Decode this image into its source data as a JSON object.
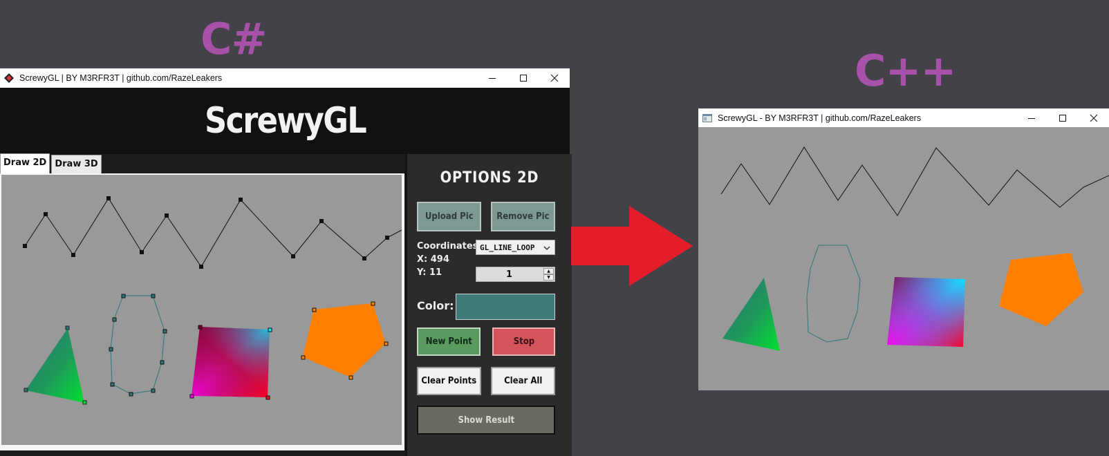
{
  "labels": {
    "left_lang": "C#",
    "right_lang": "C++"
  },
  "colors": {
    "lang_label": "#a752a8",
    "arrow": "#e51d2a",
    "background": "#434249"
  },
  "cs_window": {
    "title": "ScrewyGL | BY M3RFR3T | github.com/RazeLeakers",
    "app_icon": "red-diamond-icon",
    "controls": [
      "minimize-icon",
      "maximize-icon",
      "close-icon"
    ],
    "header_title": "ScrewyGL",
    "tabs": [
      {
        "label": "Draw 2D",
        "active": true
      },
      {
        "label": "Draw 3D",
        "active": false
      }
    ],
    "options": {
      "title": "OPTIONS 2D",
      "upload_pic": "Upload Pic",
      "remove_pic": "Remove Pic",
      "coordinates_label": "Coordinates:",
      "primitive_select": "GL_LINE_LOOP",
      "x_readout": "X: 494",
      "y_readout": "Y: 11",
      "spinner_value": "1",
      "color_label": "Color:",
      "color_value": "#417a7b",
      "new_point": "New Point",
      "stop": "Stop",
      "clear_points": "Clear Points",
      "clear_all": "Clear All",
      "show_result": "Show Result"
    }
  },
  "cpp_window": {
    "title": "ScrewyGL - BY M3RFR3T | github.com/RazeLeakers",
    "app_icon": "window-app-icon",
    "controls": [
      "minimize-icon",
      "maximize-icon",
      "close-icon"
    ]
  }
}
